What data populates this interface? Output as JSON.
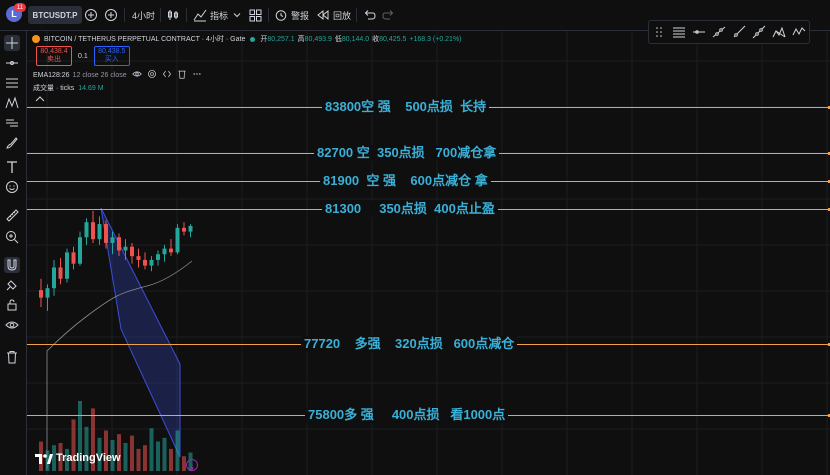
{
  "topbar": {
    "avatar_letter": "L",
    "notification_count": "11",
    "symbol": "BTCUSDT.P",
    "interval": "4小时",
    "indicators_label": "指标",
    "alert_label": "警报",
    "replay_label": "回放"
  },
  "legend": {
    "title": "BITCOIN / TETHERUS PERPETUAL CONTRACT · 4小时 · Gate",
    "open_label": "开",
    "open_value": "80,257.1",
    "high_label": "高",
    "high_value": "80,493.9",
    "low_label": "低",
    "low_value": "80,144.0",
    "close_label": "收",
    "close_value": "80,425.5",
    "change": "+168.3 (+0.21%)",
    "sell_price": "80,438.4",
    "sell_label": "卖出",
    "spread": "0.1",
    "buy_price": "80,438.5",
    "buy_label": "买入",
    "ema_label": "EMA128:26",
    "ema_params": "12 close 26 close",
    "volume_label": "成交量 · ticks",
    "volume_value": "14.69 M"
  },
  "annotations": [
    {
      "text": "83800空 强    500点损  长持"
    },
    {
      "text": "82700 空  350点损   700减仓拿"
    },
    {
      "text": "81900  空 强    600点减仓 拿"
    },
    {
      "text": "81300     350点损  400点止盈"
    },
    {
      "text": "77720    多强    320点损   600点减仓"
    },
    {
      "text": "75800多 强     400点损   看1000点"
    }
  ],
  "watermark": "TradingView",
  "colors": {
    "background": "#0f0f0f",
    "up": "#26a69a",
    "down": "#ef5350",
    "level_line": "#f0a24a",
    "annotation_text": "#3ab0d8",
    "channel": "#3b4fd6"
  },
  "candles": [
    {
      "o": 79150,
      "h": 79450,
      "l": 78700,
      "c": 78950
    },
    {
      "o": 78950,
      "h": 79300,
      "l": 78600,
      "c": 79200
    },
    {
      "o": 79200,
      "h": 79950,
      "l": 79000,
      "c": 79750
    },
    {
      "o": 79750,
      "h": 80000,
      "l": 79300,
      "c": 79450
    },
    {
      "o": 79450,
      "h": 80250,
      "l": 79350,
      "c": 80150
    },
    {
      "o": 80150,
      "h": 80300,
      "l": 79700,
      "c": 79850
    },
    {
      "o": 79850,
      "h": 80700,
      "l": 79800,
      "c": 80550
    },
    {
      "o": 80550,
      "h": 81050,
      "l": 80350,
      "c": 80950
    },
    {
      "o": 80950,
      "h": 81250,
      "l": 80400,
      "c": 80500
    },
    {
      "o": 80500,
      "h": 81100,
      "l": 80350,
      "c": 80900
    },
    {
      "o": 80900,
      "h": 81000,
      "l": 80250,
      "c": 80400
    },
    {
      "o": 80400,
      "h": 80700,
      "l": 80100,
      "c": 80550
    },
    {
      "o": 80550,
      "h": 80650,
      "l": 80050,
      "c": 80200
    },
    {
      "o": 80200,
      "h": 80500,
      "l": 79950,
      "c": 80300
    },
    {
      "o": 80300,
      "h": 80400,
      "l": 79850,
      "c": 80050
    },
    {
      "o": 80050,
      "h": 80250,
      "l": 79750,
      "c": 79950
    },
    {
      "o": 79950,
      "h": 80150,
      "l": 79700,
      "c": 79800
    },
    {
      "o": 79800,
      "h": 80050,
      "l": 79650,
      "c": 79950
    },
    {
      "o": 79950,
      "h": 80200,
      "l": 79800,
      "c": 80100
    },
    {
      "o": 80100,
      "h": 80350,
      "l": 79900,
      "c": 80250
    },
    {
      "o": 80250,
      "h": 80500,
      "l": 80050,
      "c": 80150
    },
    {
      "o": 80150,
      "h": 80900,
      "l": 80100,
      "c": 80800
    },
    {
      "o": 80800,
      "h": 80950,
      "l": 80600,
      "c": 80700
    },
    {
      "o": 80700,
      "h": 80900,
      "l": 80550,
      "c": 80850
    }
  ],
  "volumes": [
    40,
    28,
    35,
    38,
    30,
    70,
    95,
    60,
    85,
    45,
    55,
    42,
    50,
    38,
    48,
    30,
    35,
    58,
    40,
    45,
    30,
    55,
    20,
    25
  ]
}
